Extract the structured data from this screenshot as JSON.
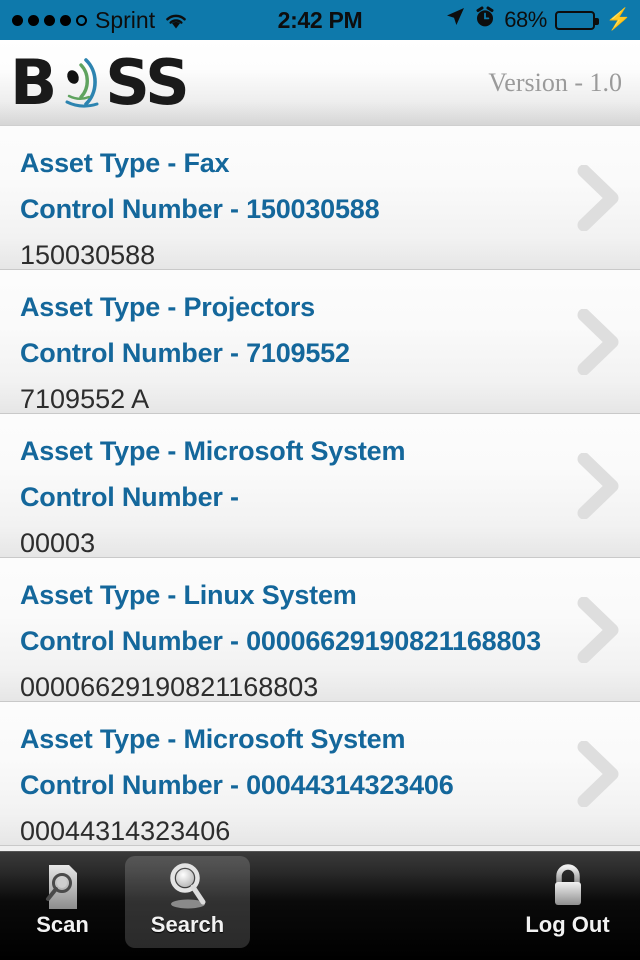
{
  "status_bar": {
    "carrier": "Sprint",
    "signal_dots_filled": 4,
    "signal_dots_total": 5,
    "wifi_icon": "wifi-icon",
    "time": "2:42 PM",
    "location_icon": "location-arrow-icon",
    "alarm_icon": "alarm-clock-icon",
    "battery_percent": "68%",
    "battery_level": 68,
    "battery_color": "#4cd964",
    "charging_icon": "lightning-bolt-icon",
    "background_color": "#0e79ab"
  },
  "header": {
    "logo_text_left": "B",
    "logo_text_right": "SS",
    "logo_name": "BOSS",
    "logo_swoosh_icon": "signal-swoosh-icon",
    "version": "Version - 1.0"
  },
  "list": {
    "accent_color": "#14679b",
    "chevron_icon": "chevron-right-icon",
    "rows": [
      {
        "asset_type_line": "Asset Type - Fax",
        "control_number_line": "Control Number - 150030588",
        "value": "150030588"
      },
      {
        "asset_type_line": "Asset Type - Projectors",
        "control_number_line": "Control Number - 7109552",
        "value": "7109552 A"
      },
      {
        "asset_type_line": "Asset Type - Microsoft System",
        "control_number_line": "Control Number -",
        "value": "00003"
      },
      {
        "asset_type_line": "Asset Type - Linux System",
        "control_number_line": "Control Number - 00006629190821168803",
        "value": "00006629190821168803"
      },
      {
        "asset_type_line": "Asset Type - Microsoft System",
        "control_number_line": "Control Number - 00044314323406",
        "value": "00044314323406"
      }
    ]
  },
  "tabbar": {
    "tabs": [
      {
        "label": "Scan",
        "icon": "document-scan-icon",
        "selected": false
      },
      {
        "label": "Search",
        "icon": "magnifying-glass-icon",
        "selected": true
      },
      {
        "label": "Log Out",
        "icon": "padlock-icon",
        "selected": false
      }
    ]
  }
}
